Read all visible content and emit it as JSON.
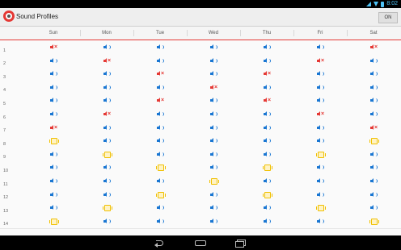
{
  "status_bar": {
    "time": "8:02",
    "icons": [
      "wifi-icon",
      "signal-icon",
      "battery-icon"
    ]
  },
  "action_bar": {
    "title": "Sound Profiles",
    "toggle_label": "ON",
    "app_icon": "sound-profiles-app-icon"
  },
  "days": [
    "Sun",
    "Mon",
    "Tue",
    "Wed",
    "Thu",
    "Fri",
    "Sat"
  ],
  "hours": [
    "1",
    "2",
    "3",
    "4",
    "5",
    "6",
    "7",
    "8",
    "9",
    "10",
    "11",
    "12",
    "13",
    "14"
  ],
  "schedule": [
    [
      "mute",
      "vol",
      "vol",
      "vol",
      "vol",
      "vol",
      "mute"
    ],
    [
      "vol",
      "mute",
      "vol",
      "vol",
      "vol",
      "mute",
      "vol"
    ],
    [
      "vol",
      "vol",
      "mute",
      "vol",
      "mute",
      "vol",
      "vol"
    ],
    [
      "vol",
      "vol",
      "vol",
      "mute",
      "vol",
      "vol",
      "vol"
    ],
    [
      "vol",
      "vol",
      "mute",
      "vol",
      "mute",
      "vol",
      "vol"
    ],
    [
      "vol",
      "mute",
      "vol",
      "vol",
      "vol",
      "mute",
      "vol"
    ],
    [
      "mute",
      "vol",
      "vol",
      "vol",
      "vol",
      "vol",
      "mute"
    ],
    [
      "vib",
      "vol",
      "vol",
      "vol",
      "vol",
      "vol",
      "vib"
    ],
    [
      "vol",
      "vib",
      "vol",
      "vol",
      "vol",
      "vib",
      "vol"
    ],
    [
      "vol",
      "vol",
      "vib",
      "vol",
      "vib",
      "vol",
      "vol"
    ],
    [
      "vol",
      "vol",
      "vol",
      "vib",
      "vol",
      "vol",
      "vol"
    ],
    [
      "vol",
      "vol",
      "vib",
      "vol",
      "vib",
      "vol",
      "vol"
    ],
    [
      "vol",
      "vib",
      "vol",
      "vol",
      "vol",
      "vib",
      "vol"
    ],
    [
      "vib",
      "vol",
      "vol",
      "vol",
      "vol",
      "vol",
      "vib"
    ]
  ],
  "icon_names": {
    "vol": "volume-on-icon",
    "mute": "volume-mute-icon",
    "vib": "vibrate-icon"
  },
  "colors": {
    "accent": "#e53935",
    "volume": "#1976d2",
    "vibrate": "#f0c000"
  },
  "nav": [
    "back-icon",
    "home-icon",
    "recent-apps-icon"
  ]
}
